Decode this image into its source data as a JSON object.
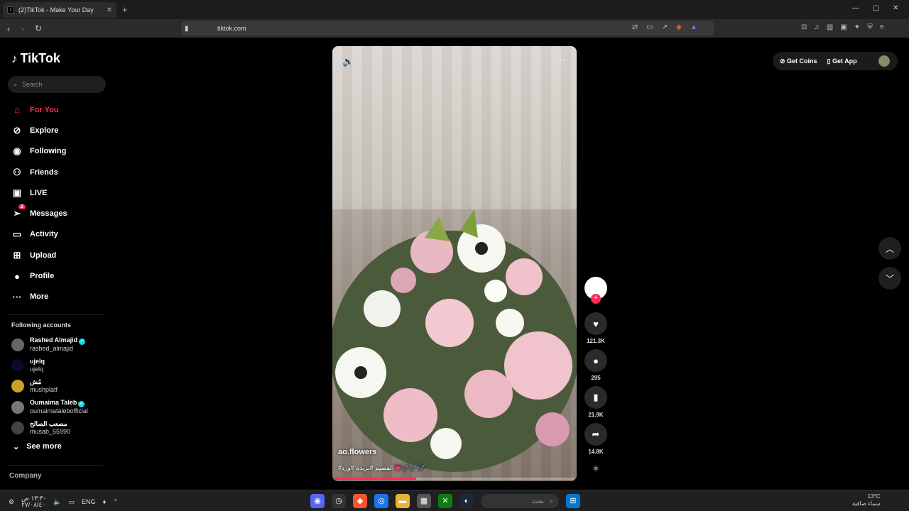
{
  "browser": {
    "tab_title": "(2)TikTok - Make Your Day",
    "url": "tiktok.com"
  },
  "sidebar": {
    "logo": "TikTok",
    "search_placeholder": "Search",
    "nav": [
      {
        "label": "For You",
        "icon": "home-icon"
      },
      {
        "label": "Explore",
        "icon": "compass-icon"
      },
      {
        "label": "Following",
        "icon": "following-icon"
      },
      {
        "label": "Friends",
        "icon": "friends-icon"
      },
      {
        "label": "LIVE",
        "icon": "live-icon"
      },
      {
        "label": "Messages",
        "icon": "messages-icon",
        "badge": "2"
      },
      {
        "label": "Activity",
        "icon": "activity-icon"
      },
      {
        "label": "Upload",
        "icon": "upload-icon"
      },
      {
        "label": "Profile",
        "icon": "profile-icon"
      },
      {
        "label": "More",
        "icon": "more-icon"
      }
    ],
    "following_header": "Following accounts",
    "following": [
      {
        "name": "Rashed Almajid",
        "username": "rashed_almajid",
        "verified": true
      },
      {
        "name": "ujelq",
        "username": "ujelq",
        "verified": false
      },
      {
        "name": "مُش",
        "username": "mushplatf",
        "verified": false
      },
      {
        "name": "Oumaima Taleb",
        "username": "oumaimatalebofficial",
        "verified": true
      },
      {
        "name": "مصعب الصالح",
        "username": "musab_55990",
        "verified": false
      }
    ],
    "see_more": "See more",
    "company": "Company"
  },
  "video": {
    "author": "ao.flowers",
    "caption": "#القصيم #بريده #ورد💗✔️✔️✔️",
    "progress": 0.34
  },
  "actions": {
    "likes": "121.3K",
    "comments": "295",
    "saves": "21.9K",
    "shares": "14.8K"
  },
  "topright": {
    "coins": "Get Coins",
    "app": "Get App"
  },
  "taskbar": {
    "time": "١٣:٣٠ ص",
    "date": "٢٧/٠٨/٤٠",
    "lang": "ENG",
    "search": "بحث",
    "weather_temp": "13°C",
    "weather_desc": "سماء صافية"
  }
}
